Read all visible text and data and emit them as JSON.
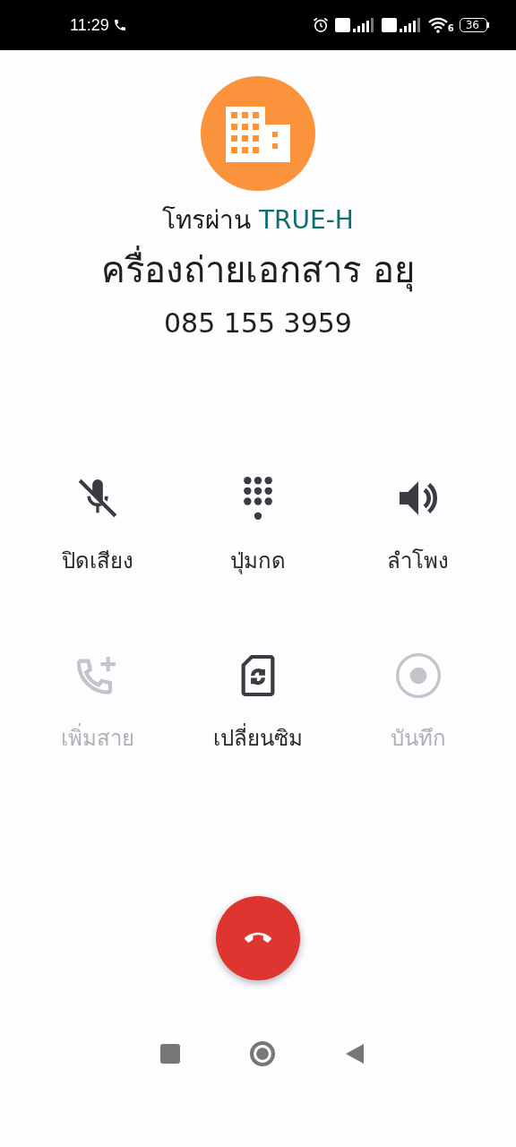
{
  "status_bar": {
    "time": "11:29",
    "wifi_label": "6",
    "battery": "36"
  },
  "caller": {
    "via_label": "โทรผ่าน",
    "carrier": "TRUE-H",
    "name": "ครื่องถ่ายเอกสาร อยุ",
    "number": "085 155 3959"
  },
  "controls": [
    {
      "kind": "mute",
      "label": "ปิดเสียง",
      "disabled": false
    },
    {
      "kind": "keypad",
      "label": "ปุ่มกด",
      "disabled": false
    },
    {
      "kind": "speaker",
      "label": "ลำโพง",
      "disabled": false
    },
    {
      "kind": "add_call",
      "label": "เพิ่มสาย",
      "disabled": true
    },
    {
      "kind": "switch_sim",
      "label": "เปลี่ยนซิม",
      "disabled": false
    },
    {
      "kind": "record",
      "label": "บันทึก",
      "disabled": true
    }
  ]
}
